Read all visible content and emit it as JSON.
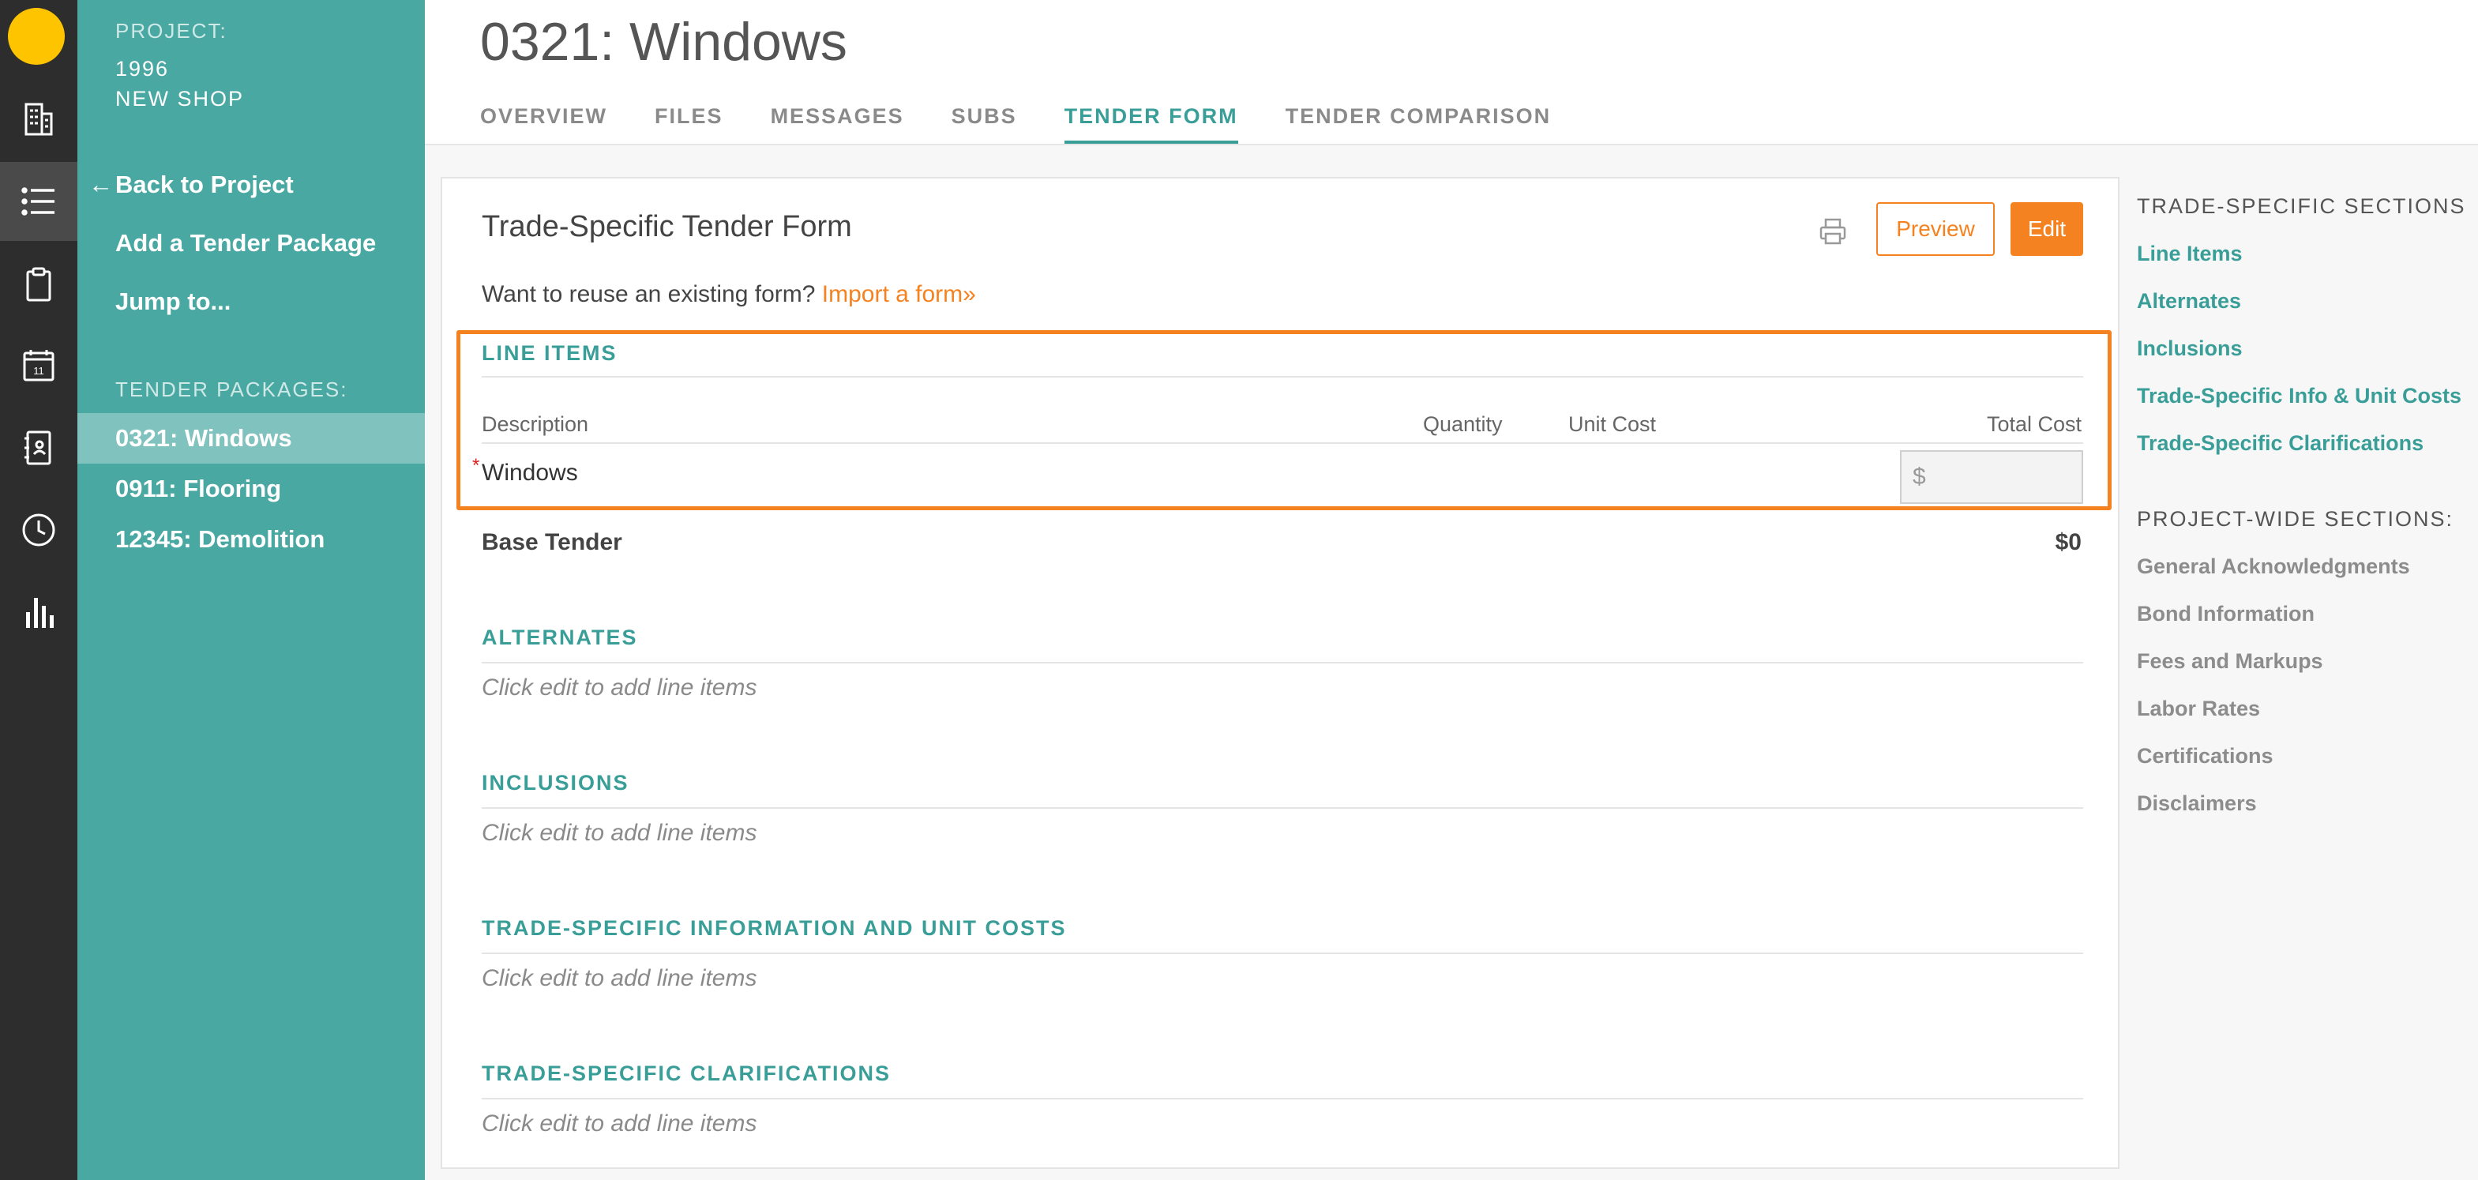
{
  "rail": {
    "icons": [
      "logo-icon",
      "building-icon",
      "list-icon",
      "clipboard-icon",
      "calendar-icon",
      "contacts-book-icon",
      "clock-icon",
      "bar-chart-icon"
    ],
    "calendar_day": "11"
  },
  "sidebar": {
    "project_label": "PROJECT:",
    "project_number": "1996",
    "project_name": "NEW SHOP",
    "back_arrow": "←",
    "back_label": "Back to Project",
    "add_package": "Add a Tender Package",
    "jump_to": "Jump to...",
    "packages_label": "TENDER PACKAGES:",
    "packages": [
      {
        "label": "0321: Windows",
        "active": true
      },
      {
        "label": "0911: Flooring",
        "active": false
      },
      {
        "label": "12345: Demolition",
        "active": false
      }
    ]
  },
  "header": {
    "title": "0321: Windows",
    "tabs": [
      "OVERVIEW",
      "FILES",
      "MESSAGES",
      "SUBS",
      "TENDER FORM",
      "TENDER COMPARISON"
    ],
    "active_tab": "TENDER FORM"
  },
  "form": {
    "title": "Trade-Specific Tender Form",
    "preview_label": "Preview",
    "edit_label": "Edit",
    "reuse_text": "Want to reuse an existing form?",
    "import_link": "Import a form»",
    "line_items": {
      "heading": "LINE ITEMS",
      "columns": [
        "Description",
        "Quantity",
        "Unit Cost",
        "Total Cost"
      ],
      "rows": [
        {
          "description": "Windows",
          "required_mark": "*",
          "total_placeholder": "$"
        }
      ]
    },
    "base_tender_label": "Base Tender",
    "base_tender_value": "$0",
    "sections": [
      {
        "heading": "ALTERNATES",
        "hint": "Click edit to add line items"
      },
      {
        "heading": "INCLUSIONS",
        "hint": "Click edit to add line items"
      },
      {
        "heading": "TRADE-SPECIFIC INFORMATION AND UNIT COSTS",
        "hint": "Click edit to add line items"
      },
      {
        "heading": "TRADE-SPECIFIC CLARIFICATIONS",
        "hint": "Click edit to add line items"
      }
    ]
  },
  "right_nav": {
    "trade_heading": "TRADE-SPECIFIC SECTIONS",
    "trade_links": [
      "Line Items",
      "Alternates",
      "Inclusions",
      "Trade-Specific Info & Unit Costs",
      "Trade-Specific Clarifications"
    ],
    "project_heading": "PROJECT-WIDE SECTIONS:",
    "project_links": [
      "General Acknowledgments",
      "Bond Information",
      "Fees and Markups",
      "Labor Rates",
      "Certifications",
      "Disclaimers"
    ]
  },
  "colors": {
    "accent_teal": "#3a9e98",
    "sidebar_teal": "#4aa8a3",
    "action_orange": "#f58220",
    "logo_yellow": "#ffc400",
    "rail_dark": "#2d2d2d"
  }
}
